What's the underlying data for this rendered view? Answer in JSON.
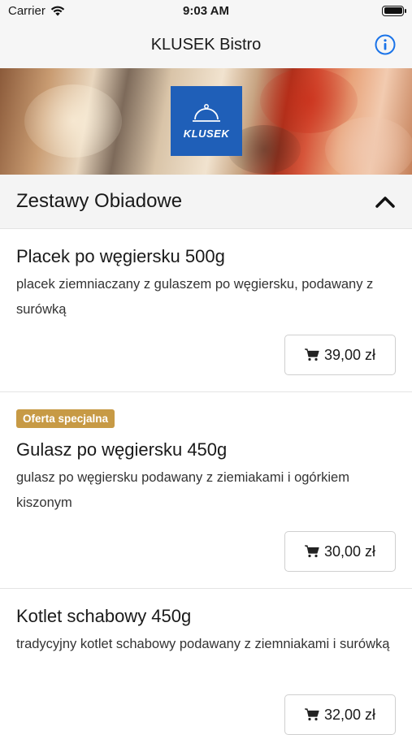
{
  "status_bar": {
    "carrier": "Carrier",
    "time": "9:03 AM"
  },
  "nav": {
    "title": "KLUSEK Bistro",
    "info_icon": "info-circle-icon"
  },
  "banner": {
    "logo_text": "KLUSEK",
    "logo_color": "#1f5fb8"
  },
  "section": {
    "title": "Zestawy Obiadowe",
    "expanded": true,
    "chevron_icon": "chevron-up-icon"
  },
  "items": [
    {
      "name": "Placek po węgiersku 500g",
      "description": "placek ziemniaczany z gulaszem po węgiersku, podawany z surówką",
      "price": "39,00 zł",
      "badge": ""
    },
    {
      "name": "Gulasz po węgiersku 450g",
      "description": "gulasz po węgiersku podawany z ziemiakami i ogórkiem kiszonym",
      "price": "30,00 zł",
      "badge": "Oferta specjalna"
    },
    {
      "name": "Kotlet schabowy 450g",
      "description": "tradycyjny kotlet schabowy podawany z ziemniakami i surówką",
      "price": "32,00 zł",
      "badge": ""
    }
  ],
  "colors": {
    "accent_blue": "#1a73e8",
    "badge_gold": "#c79a45"
  }
}
